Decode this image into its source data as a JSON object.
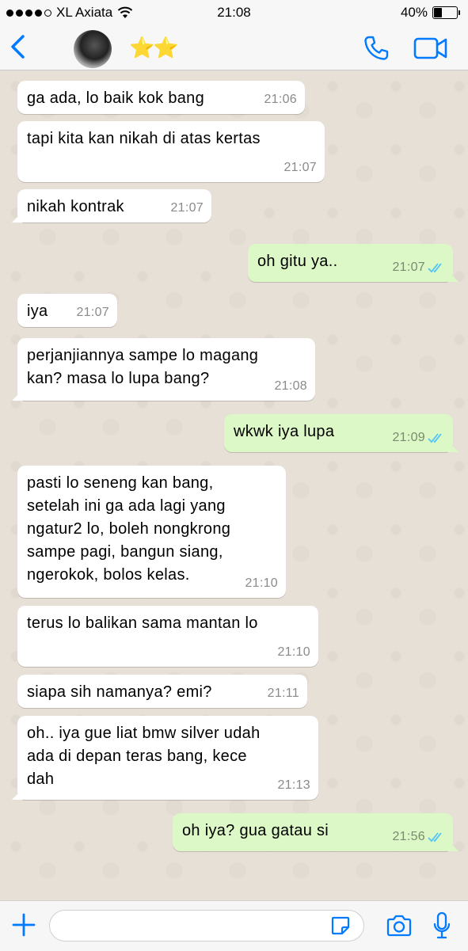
{
  "status_bar": {
    "carrier": "XL Axiata",
    "time": "21:08",
    "battery_percent": "40%",
    "battery_level": 0.4,
    "signal_bars_filled": 4,
    "signal_bars_total": 5
  },
  "header": {
    "contact_name": "⭐️⭐️",
    "icons": [
      "back-chevron-icon",
      "phone-icon",
      "video-camera-icon"
    ]
  },
  "colors": {
    "accent": "#007aff",
    "incoming_bubble": "#ffffff",
    "outgoing_bubble": "#dcf8c6",
    "read_ticks": "#4fc3f7"
  },
  "messages": [
    {
      "dir": "in",
      "text": "ga ada, lo baik kok bang",
      "time": "21:06"
    },
    {
      "dir": "in",
      "text": "tapi kita kan nikah di atas kertas",
      "time": "21:07"
    },
    {
      "dir": "in",
      "text": "nikah kontrak",
      "time": "21:07"
    },
    {
      "dir": "out",
      "text": "oh gitu ya..",
      "time": "21:07",
      "status": "read"
    },
    {
      "dir": "in",
      "text": "iya",
      "time": "21:07"
    },
    {
      "dir": "in",
      "text": "perjanjiannya sampe lo magang\nkan? masa lo lupa bang?",
      "time": "21:08"
    },
    {
      "dir": "out",
      "text": "wkwk iya lupa",
      "time": "21:09",
      "status": "read"
    },
    {
      "dir": "in",
      "text": "pasti lo seneng kan bang,\nsetelah ini ga ada lagi yang\nngatur2 lo, boleh nongkrong\nsampe pagi, bangun siang,\nngerokok, bolos kelas.",
      "time": "21:10"
    },
    {
      "dir": "in",
      "text": "terus lo balikan sama mantan lo",
      "time": "21:10"
    },
    {
      "dir": "in",
      "text": "siapa sih namanya? emi?",
      "time": "21:11"
    },
    {
      "dir": "in",
      "text": "oh.. iya gue liat bmw silver udah\nada di depan teras bang, kece\ndah",
      "time": "21:13"
    },
    {
      "dir": "out",
      "text": "oh iya? gua gatau si",
      "time": "21:56",
      "status": "read"
    }
  ],
  "composer": {
    "placeholder": "",
    "value": "",
    "icons": [
      "plus-icon",
      "sticker-icon",
      "camera-icon",
      "microphone-icon"
    ]
  }
}
